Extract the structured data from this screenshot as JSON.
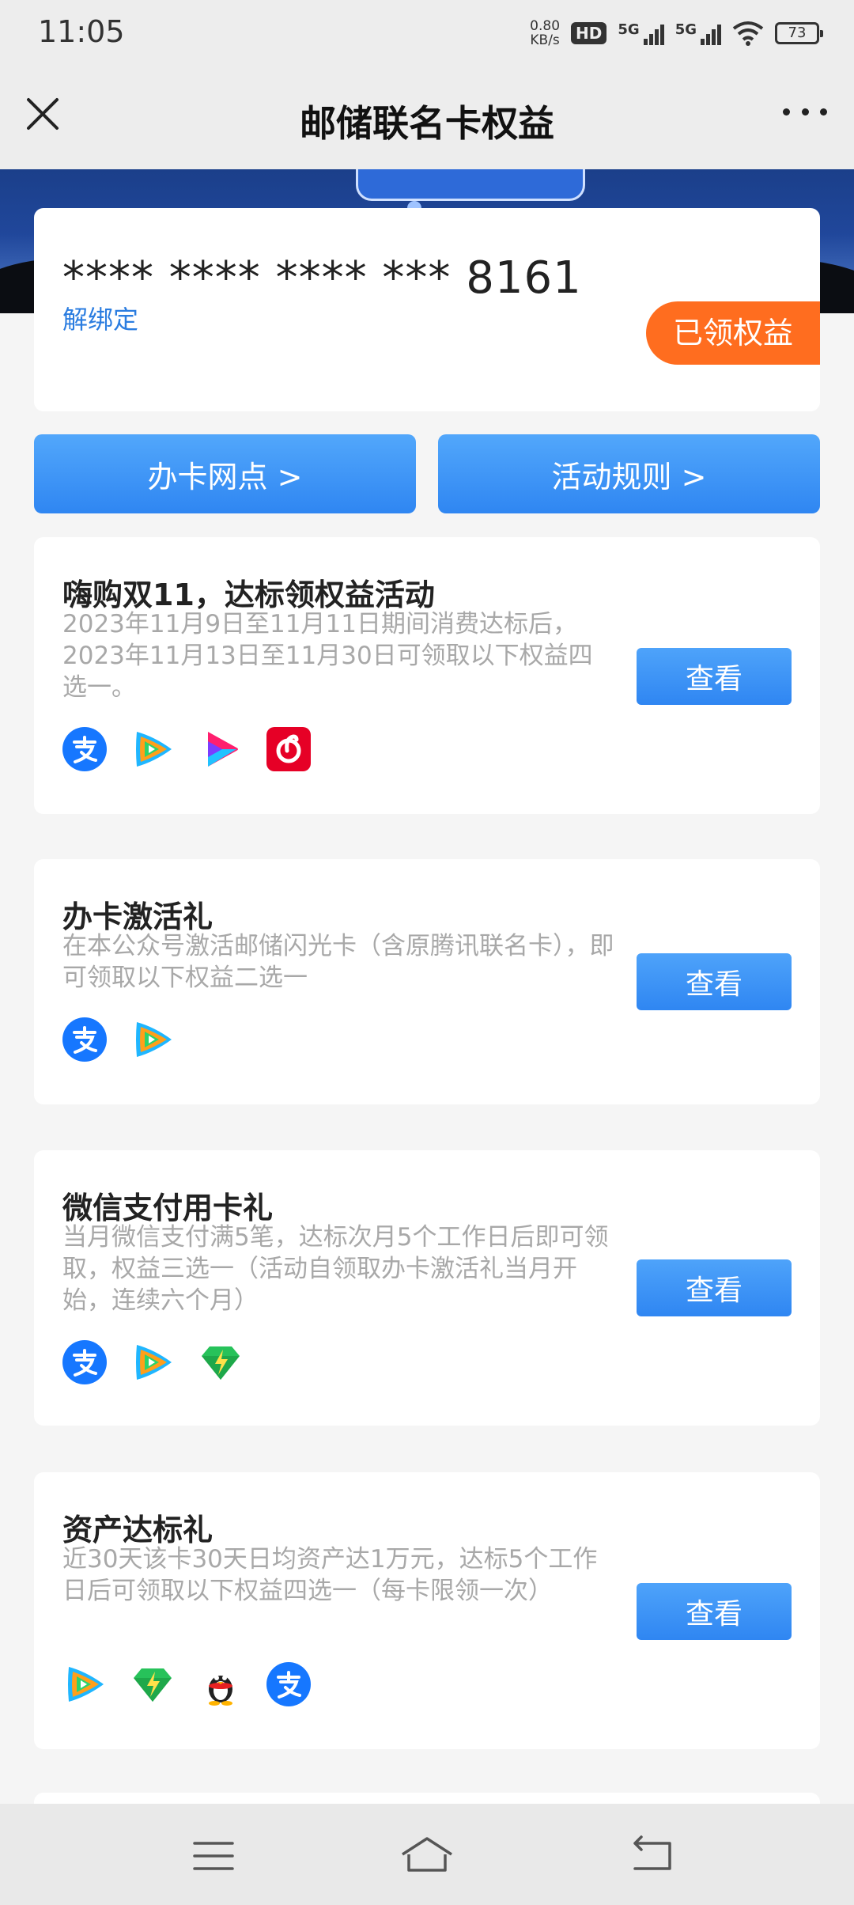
{
  "status_bar": {
    "time": "11:05",
    "speed_value": "0.80",
    "speed_unit": "KB/s",
    "hd": "HD",
    "sim1": "5G",
    "sim2": "5G",
    "battery": "73"
  },
  "header": {
    "title": "邮储联名卡权益"
  },
  "card": {
    "number": "**** **** **** *** 8161",
    "unbind_label": "解绑定",
    "badge": "已领权益"
  },
  "actions": {
    "branch_label": "办卡网点 >",
    "rules_label": "活动规则 >"
  },
  "offers": [
    {
      "title": "嗨购双11，达标领权益活动",
      "desc": "2023年11月9日至11月11日期间消费达标后，2023年11月13日至11月30日可领取以下权益四选一。",
      "button": "查看",
      "icons": [
        "alipay-icon",
        "tencent-video-icon",
        "youku-icon",
        "netease-music-icon"
      ]
    },
    {
      "title": "办卡激活礼",
      "desc": "在本公众号激活邮储闪光卡（含原腾讯联名卡），即可领取以下权益二选一",
      "button": "查看",
      "icons": [
        "alipay-icon",
        "tencent-video-icon"
      ]
    },
    {
      "title": "微信支付用卡礼",
      "desc": "当月微信支付满5笔，达标次月5个工作日后即可领取，权益三选一（活动自领取办卡激活礼当月开始，连续六个月）",
      "button": "查看",
      "icons": [
        "alipay-icon",
        "tencent-video-icon",
        "green-diamond-icon"
      ]
    },
    {
      "title": "资产达标礼",
      "desc": "近30天该卡30天日均资产达1万元，达标5个工作日后可领取以下权益四选一（每卡限领一次）",
      "button": "查看",
      "icons": [
        "tencent-video-icon",
        "green-diamond-icon",
        "qq-penguin-icon",
        "alipay-icon"
      ]
    }
  ],
  "colors": {
    "accent_blue": "#2f86f2",
    "badge_orange": "#ff6d1f",
    "link_blue": "#2b7de0"
  }
}
